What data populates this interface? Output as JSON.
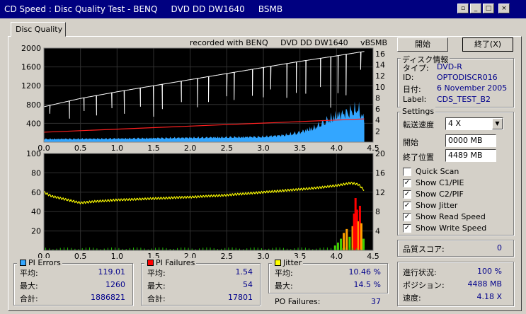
{
  "window": {
    "title": "CD Speed : Disc Quality Test - BENQ     DVD DD DW1640     BSMB",
    "buttons": [
      "▫",
      "_",
      "□",
      "×"
    ]
  },
  "tab": "Disc Quality",
  "recorded": "recorded with BENQ     DVD DD DW1640     vBSMB",
  "buttons": {
    "start": "開始",
    "end": "終了(X)"
  },
  "disc_info": {
    "title": "ディスク情報",
    "rows": [
      {
        "label": "タイプ:",
        "value": "DVD-R"
      },
      {
        "label": "ID:",
        "value": "OPTODISCR016"
      },
      {
        "label": "日付:",
        "value": "6 November 2005"
      },
      {
        "label": "Label:",
        "value": "CDS_TEST_B2"
      }
    ]
  },
  "settings": {
    "title": "Settings",
    "speed_label": "転送速度",
    "speed_value": "4 X",
    "start_label": "開始",
    "start_value": "0000 MB",
    "end_label": "終了位置",
    "end_value": "4489 MB",
    "checks": [
      {
        "label": "Quick Scan",
        "checked": ""
      },
      {
        "label": "Show C1/PIE",
        "checked": "✓"
      },
      {
        "label": "Show C2/PIF",
        "checked": "✓"
      },
      {
        "label": "Show Jitter",
        "checked": "✓"
      },
      {
        "label": "Show Read Speed",
        "checked": "✓"
      },
      {
        "label": "Show Write Speed",
        "checked": "✓"
      }
    ]
  },
  "quality": {
    "label": "品質スコア:",
    "value": "0"
  },
  "progress": [
    {
      "label": "進行状況:",
      "value": "100 %"
    },
    {
      "label": "ポジション:",
      "value": "4488 MB"
    },
    {
      "label": "速度:",
      "value": "4.18 X"
    }
  ],
  "pi_errors": {
    "title": "PI Errors",
    "color": "#33a6ff",
    "rows": [
      {
        "label": "平均:",
        "value": "119.01"
      },
      {
        "label": "最大:",
        "value": "1260"
      },
      {
        "label": "合計:",
        "value": "1886821"
      }
    ]
  },
  "pi_failures": {
    "title": "PI Failures",
    "color": "#ff0000",
    "rows": [
      {
        "label": "平均:",
        "value": "1.54"
      },
      {
        "label": "最大:",
        "value": "54"
      },
      {
        "label": "合計:",
        "value": "17801"
      }
    ]
  },
  "jitter": {
    "title": "Jitter",
    "color": "#ffff00",
    "rows": [
      {
        "label": "平均:",
        "value": "10.46 %"
      },
      {
        "label": "最大:",
        "value": "14.5 %"
      }
    ]
  },
  "po_failures": {
    "label": "PO Failures:",
    "value": "37"
  },
  "chart_data": [
    {
      "type": "area",
      "x_ticks": [
        "0.0",
        "0.5",
        "1.0",
        "1.5",
        "2.0",
        "2.5",
        "3.0",
        "3.5",
        "4.0",
        "4.5"
      ],
      "xlim": [
        0,
        4.5
      ],
      "ylim": [
        0,
        2000
      ],
      "y_ticks": [
        "2000",
        "1600",
        "1200",
        "800",
        "400"
      ],
      "y2lim": [
        0,
        17
      ],
      "y2_ticks": [
        "16",
        "14",
        "12",
        "10",
        "8",
        "6",
        "4",
        "2"
      ],
      "pie_x": [
        0,
        0.5,
        1.0,
        1.5,
        2.0,
        2.5,
        3.0,
        3.3,
        3.5,
        3.7,
        3.8,
        3.9,
        4.0,
        4.1,
        4.2,
        4.3,
        4.38
      ],
      "pie_y": [
        70,
        75,
        80,
        90,
        100,
        110,
        120,
        160,
        220,
        330,
        420,
        520,
        600,
        640,
        700,
        750,
        500
      ],
      "read_speed_x": [
        0,
        0.2,
        0.5,
        1.0,
        1.5,
        2.0,
        2.5,
        3.0,
        3.5,
        4.0,
        4.38
      ],
      "read_speed_y": [
        6.4,
        7.0,
        7.9,
        9.1,
        10.2,
        11.3,
        12.4,
        13.5,
        14.6,
        15.6,
        16.4
      ],
      "write_speed_x": [
        0,
        4.38
      ],
      "write_speed_y": [
        1.8,
        4.2
      ],
      "dips_x": [
        0.08,
        0.35,
        0.55,
        0.72,
        0.93,
        1.1,
        1.32,
        1.5,
        1.62,
        1.88,
        2.1,
        2.25,
        2.5,
        2.6,
        2.85,
        3.0,
        3.1,
        3.32,
        3.45,
        3.58,
        3.78,
        3.92,
        4.02,
        4.13,
        4.33
      ],
      "dips_depth": [
        1.5,
        3.2,
        2.4,
        3.6,
        2.8,
        4.2,
        3.4,
        5.6,
        4.5,
        3.8,
        5.2,
        4.6,
        4.1,
        5.0,
        4.8,
        5.4,
        4.2,
        6.2,
        5.6,
        6.0,
        5.2,
        9.2,
        6.8,
        7.4,
        3.2
      ]
    },
    {
      "type": "bar",
      "x_ticks": [
        "0.0",
        "0.5",
        "1.0",
        "1.5",
        "2.0",
        "2.5",
        "3.0",
        "3.5",
        "4.0",
        "4.5"
      ],
      "xlim": [
        0,
        4.5
      ],
      "ylim": [
        0,
        100
      ],
      "y_ticks": [
        "100",
        "80",
        "60",
        "40",
        "20"
      ],
      "y2lim": [
        0,
        20
      ],
      "y2_ticks": [
        "20",
        "16",
        "12",
        "8",
        "4"
      ],
      "jitter_x": [
        0,
        0.1,
        0.3,
        0.5,
        0.7,
        1.0,
        1.5,
        2.0,
        2.5,
        3.0,
        3.5,
        3.8,
        4.0,
        4.2,
        4.3,
        4.38
      ],
      "jitter_y": [
        12.0,
        11.2,
        10.5,
        9.8,
        10.1,
        10.4,
        10.7,
        11.0,
        11.4,
        12.0,
        12.6,
        13.0,
        13.4,
        13.9,
        13.6,
        12.4
      ],
      "pif_x": [
        3.98,
        4.02,
        4.06,
        4.1,
        4.14,
        4.18,
        4.22,
        4.24,
        4.26,
        4.28,
        4.3,
        4.32,
        4.34,
        4.37
      ],
      "pif_y": [
        5,
        8,
        12,
        18,
        22,
        14,
        25,
        38,
        54,
        42,
        30,
        46,
        28,
        12
      ]
    }
  ]
}
